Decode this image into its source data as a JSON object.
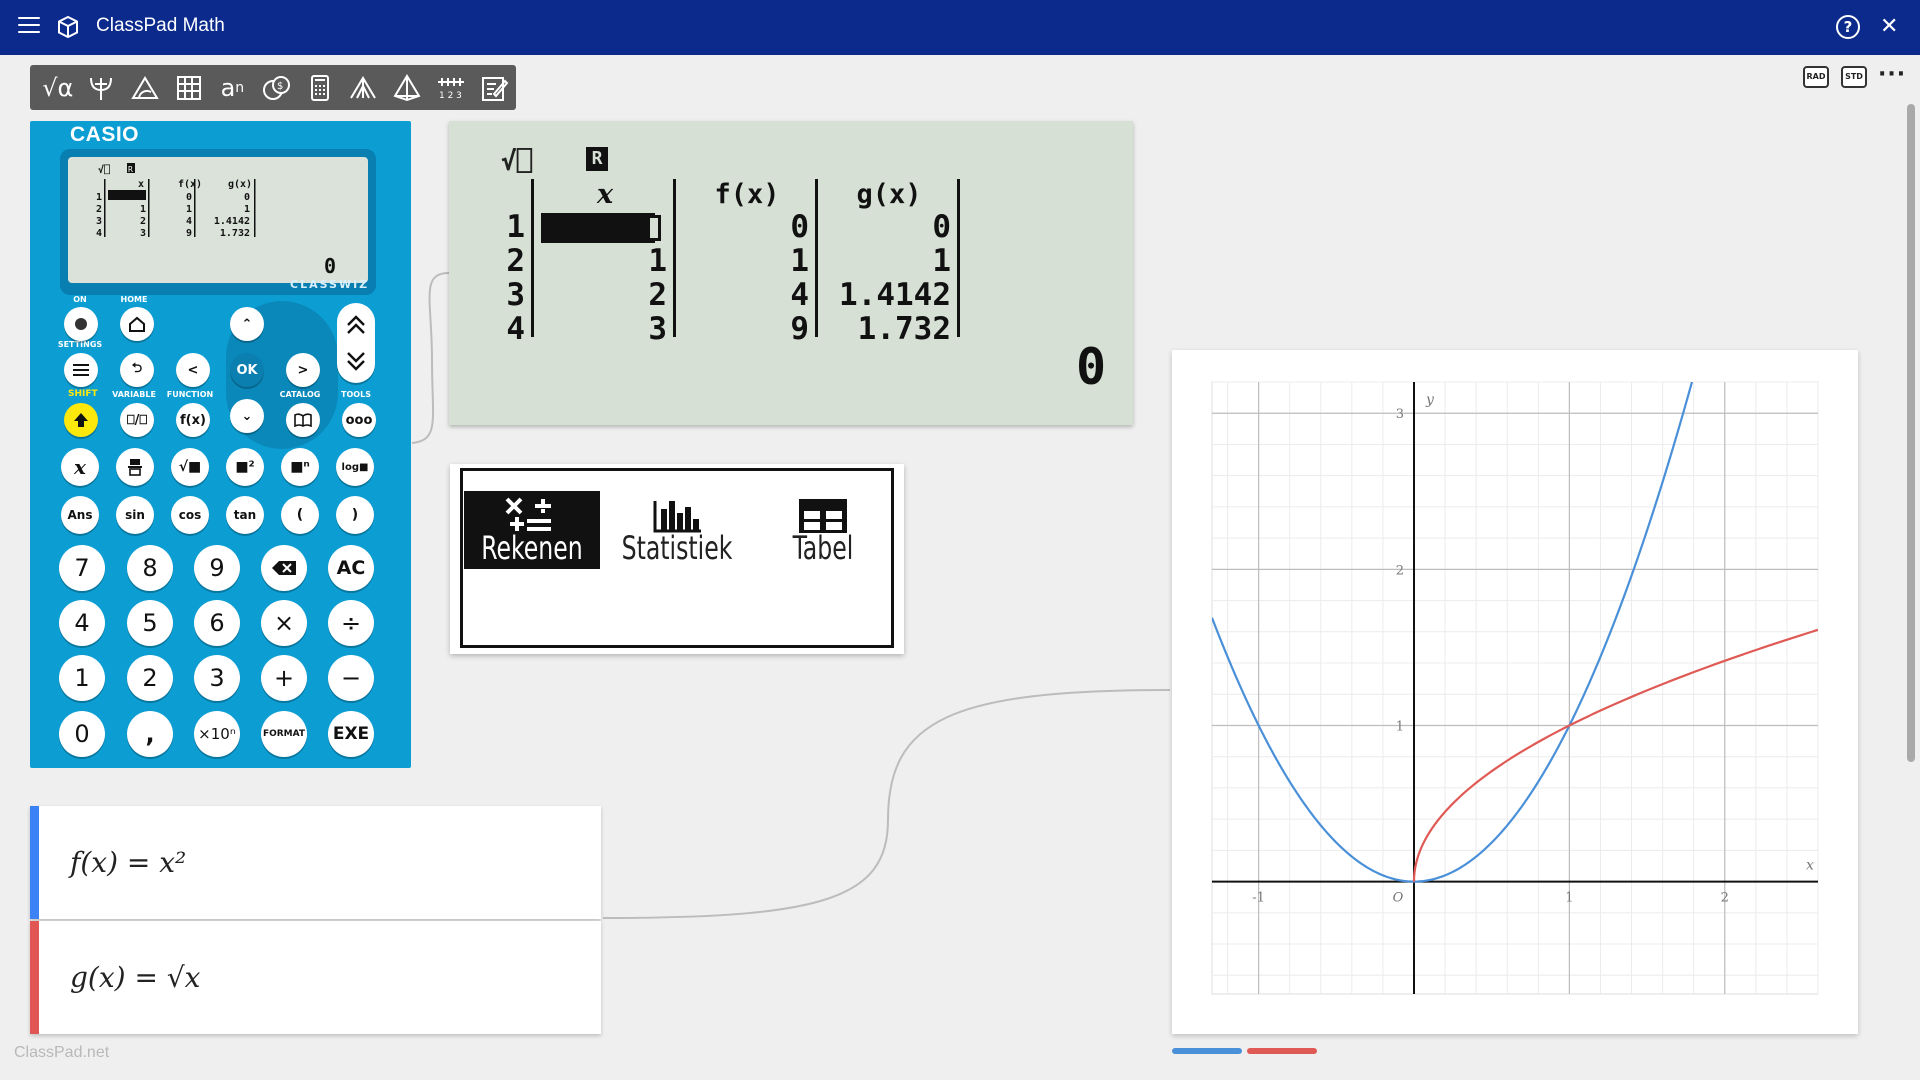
{
  "app": {
    "title": "ClassPad Math"
  },
  "toolbar": {
    "tools": [
      "math-tool",
      "statistics-tool",
      "geometry-tool",
      "table-tool",
      "sequence-tool",
      "finance-tool",
      "calculator-tool",
      "distribution-tool",
      "solid-tool",
      "number-line-tool",
      "notes-tool"
    ]
  },
  "right_controls": {
    "rad_label": "RAD",
    "std_label": "STD",
    "more_label": "···"
  },
  "calculator": {
    "brand": "CASIO",
    "model": "CLASSWIZ",
    "mini_screen": {
      "headers": [
        "x",
        "f(x)",
        "g(x)"
      ],
      "rows": [
        [
          "1",
          "",
          "0",
          "0"
        ],
        [
          "2",
          "1",
          "1",
          "1"
        ],
        [
          "3",
          "2",
          "4",
          "1.4142"
        ],
        [
          "4",
          "3",
          "9",
          "1.732"
        ]
      ],
      "result": "0"
    },
    "labels": {
      "on": "ON",
      "home": "HOME",
      "settings": "SETTINGS",
      "shift": "SHIFT",
      "variable": "VARIABLE",
      "function": "FUNCTION",
      "catalog": "CATALOG",
      "tools": "TOOLS"
    },
    "keys": {
      "ok": "OK",
      "left": "<",
      "right": ">",
      "up": "^",
      "down": "v",
      "func": "f(x)",
      "tools": "ooo",
      "x": "x",
      "frac": "⎕/⎕",
      "sqrt": "√■",
      "sq": "■²",
      "pow": "■ⁿ",
      "log": "log■",
      "ans": "Ans",
      "sin": "sin",
      "cos": "cos",
      "tan": "tan",
      "lparen": "(",
      "rparen": ")",
      "n7": "7",
      "n8": "8",
      "n9": "9",
      "del": "⌫",
      "ac": "AC",
      "n4": "4",
      "n5": "5",
      "n6": "6",
      "mul": "×",
      "div": "÷",
      "n1": "1",
      "n2": "2",
      "n3": "3",
      "add": "+",
      "sub": "−",
      "n0": "0",
      "comma": ",",
      "x10": "×10ⁿ",
      "format": "FORMAT",
      "exe": "EXE"
    }
  },
  "lcd": {
    "headers": [
      "x",
      "f(x)",
      "g(x)"
    ],
    "rows": [
      {
        "n": "1",
        "x": "",
        "f": "0",
        "g": "0"
      },
      {
        "n": "2",
        "x": "1",
        "f": "1",
        "g": "1"
      },
      {
        "n": "3",
        "x": "2",
        "f": "4",
        "g": "1.4142"
      },
      {
        "n": "4",
        "x": "3",
        "f": "9",
        "g": "1.732"
      }
    ],
    "result": "0"
  },
  "menu": {
    "items": [
      {
        "label": "Rekenen",
        "icon": "calculate-icon",
        "selected": true
      },
      {
        "label": "Statistiek",
        "icon": "statistics-icon",
        "selected": false
      },
      {
        "label": "Tabel",
        "icon": "table-icon",
        "selected": false
      }
    ]
  },
  "expressions": [
    {
      "name": "f",
      "text": "f(x) = x²",
      "color": "#3b82f6"
    },
    {
      "name": "g",
      "text": "g(x) = √x",
      "color": "#e25555"
    }
  ],
  "colors": {
    "titlebar": "#0b2a8c",
    "calculator": "#0c9ed3",
    "f_curve": "#4a90d9",
    "g_curve": "#e05a55"
  },
  "chart_data": {
    "type": "line",
    "xlabel": "x",
    "ylabel": "y",
    "xlim": [
      -1.3,
      2.6
    ],
    "ylim": [
      -0.72,
      3.2
    ],
    "x_ticks": [
      "-1",
      "O",
      "1",
      "2"
    ],
    "y_ticks": [
      "1",
      "2",
      "3"
    ],
    "grid": true,
    "series": [
      {
        "name": "f(x) = x²",
        "function": "x^2",
        "color": "#4a90d9"
      },
      {
        "name": "g(x) = √x",
        "function": "sqrt(x)",
        "color": "#e05a55"
      }
    ]
  },
  "watermark": "ClassPad.net"
}
